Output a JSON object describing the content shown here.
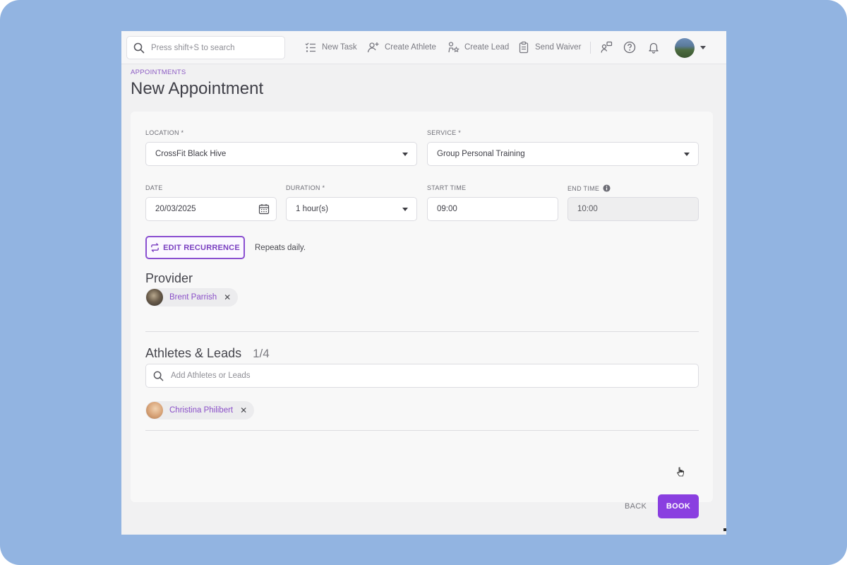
{
  "topbar": {
    "search_placeholder": "Press shift+S to search",
    "actions": {
      "new_task": "New Task",
      "create_athlete": "Create Athlete",
      "create_lead": "Create Lead",
      "send_waiver": "Send Waiver"
    }
  },
  "breadcrumb": "APPOINTMENTS",
  "page_title": "New Appointment",
  "form": {
    "location_label": "LOCATION *",
    "location_value": "CrossFit Black Hive",
    "service_label": "SERVICE *",
    "service_value": "Group Personal Training",
    "date_label": "DATE",
    "date_value": "20/03/2025",
    "duration_label": "DURATION *",
    "duration_value": "1 hour(s)",
    "start_label": "START TIME",
    "start_value": "09:00",
    "end_label": "END TIME",
    "end_value": "10:00",
    "edit_recurrence": "EDIT RECURRENCE",
    "recurrence_text": "Repeats daily."
  },
  "provider": {
    "title": "Provider",
    "name": "Brent Parrish"
  },
  "athletes": {
    "title": "Athletes & Leads",
    "count": "1/4",
    "search_placeholder": "Add Athletes or Leads",
    "items": [
      {
        "name": "Christina Philibert"
      }
    ]
  },
  "buttons": {
    "back": "BACK",
    "book": "BOOK"
  },
  "colors": {
    "accent": "#8a3fe0",
    "frame": "#92b4e1"
  }
}
